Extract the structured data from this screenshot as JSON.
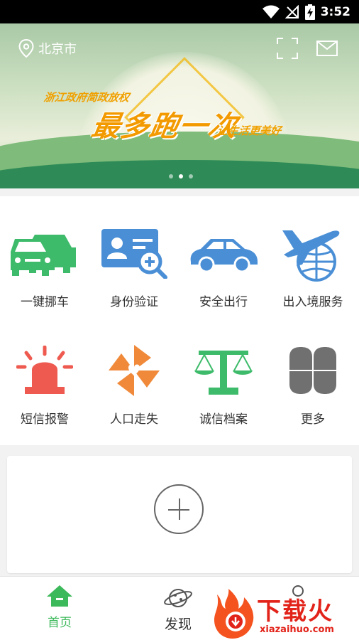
{
  "status_bar": {
    "time": "3:52",
    "icons": [
      "wifi-icon",
      "no-signal-icon",
      "battery-charging-icon"
    ]
  },
  "header": {
    "location": "北京市",
    "location_icon": "location-pin-icon",
    "scan_icon": "scan-icon",
    "mail_icon": "mail-icon"
  },
  "banner": {
    "subtitle_left": "浙江政府简政放权",
    "title": "最多跑一次",
    "subtitle_right": "让生活更美好",
    "slides": 3,
    "active_slide": 2
  },
  "services": [
    {
      "label": "一键挪车",
      "icon": "cars-icon",
      "color": "#3dbb6a"
    },
    {
      "label": "身份验证",
      "icon": "id-card-search-icon",
      "color": "#4a8fd6"
    },
    {
      "label": "安全出行",
      "icon": "car-icon",
      "color": "#4a8fd6"
    },
    {
      "label": "出入境服务",
      "icon": "airplane-globe-icon",
      "color": "#4a8fd6"
    },
    {
      "label": "短信报警",
      "icon": "alarm-light-icon",
      "color": "#ee5a4f"
    },
    {
      "label": "人口走失",
      "icon": "pinwheel-icon",
      "color": "#f08a3a"
    },
    {
      "label": "诚信档案",
      "icon": "scale-icon",
      "color": "#3dbb6a"
    },
    {
      "label": "更多",
      "icon": "more-grid-icon",
      "color": "#707070"
    }
  ],
  "add_card": {
    "icon": "add-circle-icon"
  },
  "bottom_nav": [
    {
      "label": "首页",
      "icon": "home-icon",
      "active": true
    },
    {
      "label": "发现",
      "icon": "planet-icon",
      "active": false
    },
    {
      "label": "",
      "icon": "person-icon",
      "active": false
    }
  ],
  "watermark": {
    "brand": "下载火",
    "url": "xiazaihuo.com"
  },
  "colors": {
    "accent": "#3cb95a",
    "banner_text": "#f29a00"
  }
}
